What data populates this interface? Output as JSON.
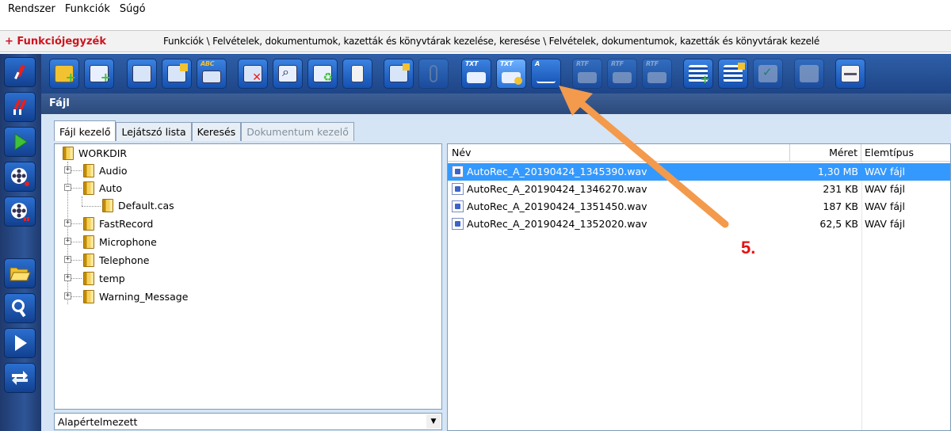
{
  "menu": [
    "Rendszer",
    "Funkciók",
    "Súgó"
  ],
  "breadcrumb": {
    "title": "+ Funkciójegyzék",
    "path": "Funkciók \\ Felvételek, dokumentumok, kazetták és könyvtárak kezelése, keresése \\ Felvételek, dokumentumok, kazetták és könyvtárak kezelé"
  },
  "toolbar_captions": {
    "txt1": "TXT",
    "txt2": "TXT",
    "a": "A",
    "rtf1": "RTF",
    "rtf2": "RTF",
    "rtf3": "RTF",
    "abc": "ABC"
  },
  "panel_title": "Fájl",
  "tabs": [
    "Fájl kezelő",
    "Lejátszó lista",
    "Keresés",
    "Dokumentum kezelő"
  ],
  "tree": {
    "root": "WORKDIR",
    "items": [
      "Audio",
      "Auto",
      "Default.cas",
      "FastRecord",
      "Microphone",
      "Telephone",
      "temp",
      "Warning_Message"
    ]
  },
  "combo_value": "Alapértelmezett",
  "filelist": {
    "headers": {
      "name": "Név",
      "size": "Méret",
      "type": "Elemtípus"
    },
    "rows": [
      {
        "name": "AutoRec_A_20190424_1345390.wav",
        "size": "1,30 MB",
        "type": "WAV fájl"
      },
      {
        "name": "AutoRec_A_20190424_1346270.wav",
        "size": "231 KB",
        "type": "WAV fájl"
      },
      {
        "name": "AutoRec_A_20190424_1351450.wav",
        "size": "187 KB",
        "type": "WAV fájl"
      },
      {
        "name": "AutoRec_A_20190424_1352020.wav",
        "size": "62,5 KB",
        "type": "WAV fájl"
      }
    ]
  },
  "annotation": "5.",
  "colors": {
    "annotation_arrow": "#f39a4c",
    "annotation_text": "#e81010",
    "selection": "#3399ff",
    "toolbar": "#1e4586"
  }
}
